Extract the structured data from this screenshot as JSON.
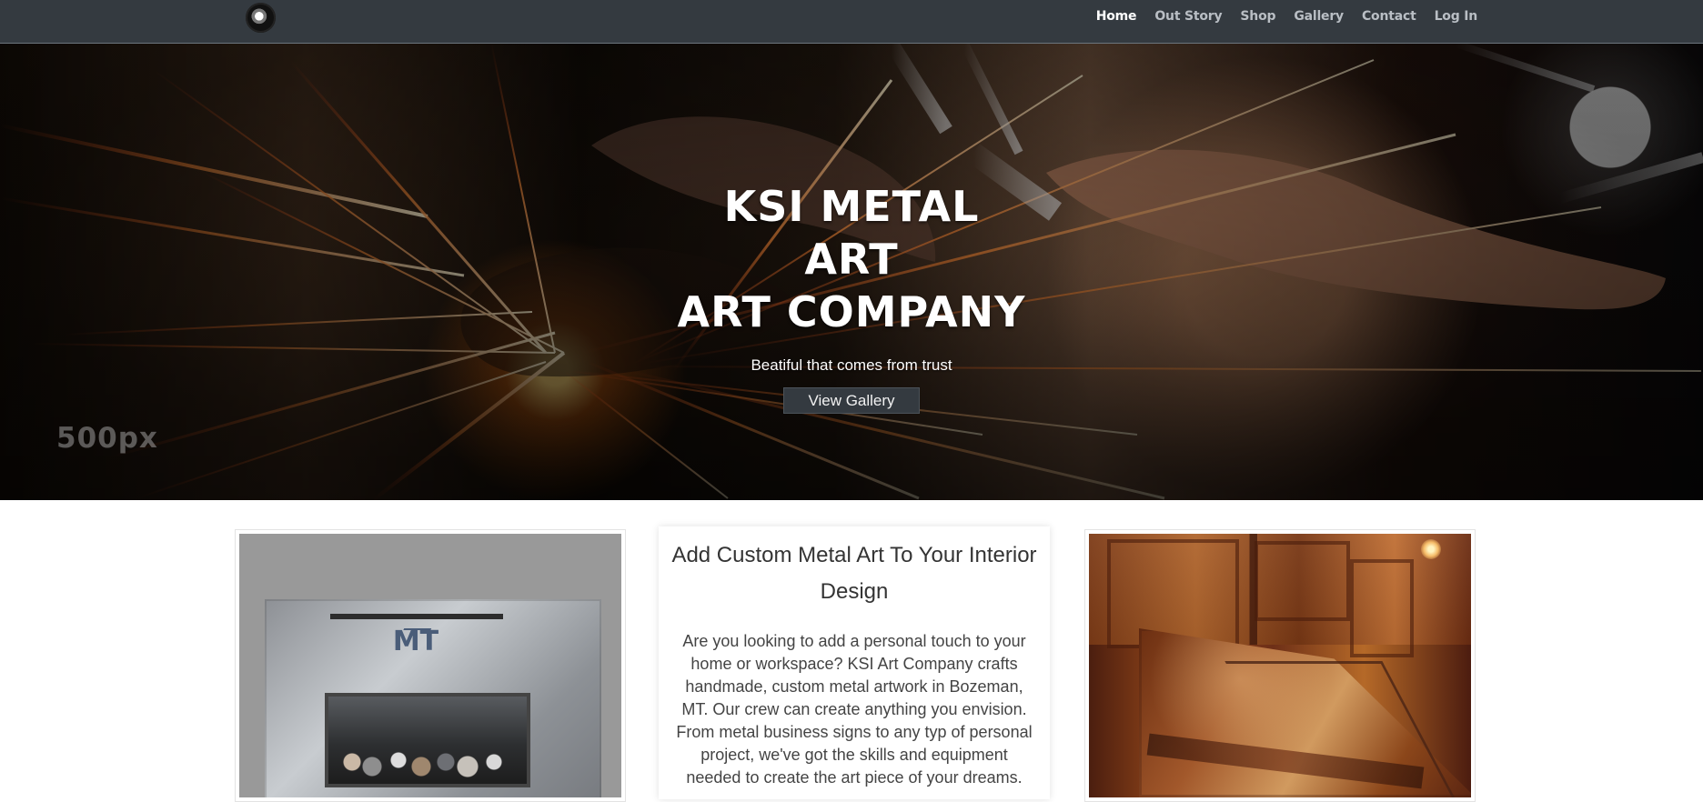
{
  "navbar": {
    "brand_logo_icon": "dragon-logo-icon",
    "items": [
      {
        "label": "Home",
        "active": true
      },
      {
        "label": "Out Story",
        "active": false
      },
      {
        "label": "Shop",
        "active": false
      },
      {
        "label": "Gallery",
        "active": false
      },
      {
        "label": "Contact",
        "active": false
      },
      {
        "label": "Log In",
        "active": false
      }
    ]
  },
  "hero": {
    "title_line_1": "KSI METAL ART",
    "title_line_2": "ART COMPANY",
    "subtitle": "Beatiful that comes from trust",
    "button_label": "View Gallery",
    "watermark": "500px"
  },
  "content": {
    "left_image_icon": "fireplace-image-icon",
    "right_image_icon": "metal-range-hood-image-icon",
    "heading": "Add Custom Metal Art To Your Interior Design",
    "body": "Are you looking to add a personal touch to your home or workspace? KSI Art Company crafts handmade, custom metal artwork in Bozeman, MT. Our crew can create anything you envision. From metal business signs to any typ of personal project, we've got the skills and equipment needed to create the art piece of your dreams."
  },
  "left_photo": {
    "logo_text": "MT"
  }
}
